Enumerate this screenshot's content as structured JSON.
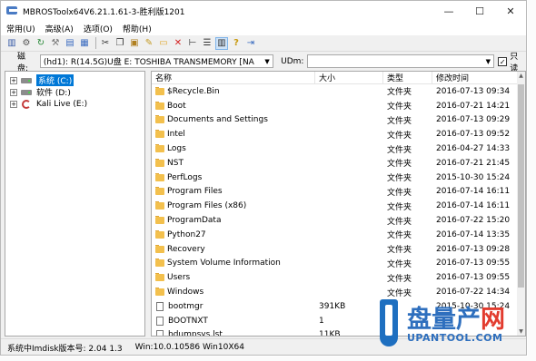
{
  "window": {
    "title": "MBROSToolx64V6.21.1.61-3-胜利版1201",
    "minimize_glyph": "—",
    "maximize_glyph": "☐",
    "close_glyph": "✕"
  },
  "menu": [
    {
      "label": "常用(U)"
    },
    {
      "label": "高级(A)"
    },
    {
      "label": "选项(O)"
    },
    {
      "label": "帮助(H)"
    }
  ],
  "toolbar": {
    "icons": [
      "book-icon",
      "gear-icon",
      "refresh-icon",
      "tools-icon",
      "backup-icon",
      "restore-icon",
      "cut-icon",
      "copy-icon",
      "paste-icon",
      "edit-icon",
      "new-folder-icon",
      "delete-icon",
      "tree-view-icon",
      "list-view-icon",
      "details-view-icon",
      "help-icon",
      "exit-icon"
    ],
    "glyphs": [
      "▥",
      "⚙",
      "↻",
      "⚒",
      "▤",
      "▦",
      "✂",
      "❐",
      "▣",
      "✎",
      "▭",
      "✕",
      "⊢",
      "☰",
      "▥",
      "?",
      "⇥"
    ]
  },
  "diskbar": {
    "disk_label": "磁盘:",
    "disk_value": "(hd1): R(14.5G)U盘  E: TOSHIBA  TRANSMEMORY [NA",
    "ud_label": "UDm:",
    "ud_value": "",
    "readonly_checked": true,
    "readonly_label": "只读"
  },
  "tree": {
    "items": [
      {
        "label": "系统 (C:)",
        "expand": "+",
        "icon": "drive-icon",
        "selected": true
      },
      {
        "label": "软件 (D:)",
        "expand": "+",
        "icon": "drive-icon",
        "selected": false
      },
      {
        "label": "Kali Live (E:)",
        "expand": "+",
        "icon": "kali-drive-icon",
        "selected": false
      }
    ]
  },
  "list": {
    "columns": {
      "name": "名称",
      "size": "大小",
      "type": "类型",
      "time": "修改时间"
    },
    "rows": [
      {
        "name": "$Recycle.Bin",
        "size": "",
        "type": "文件夹",
        "time": "2016-07-13 09:34",
        "icon": "folder"
      },
      {
        "name": "Boot",
        "size": "",
        "type": "文件夹",
        "time": "2016-07-21 14:21",
        "icon": "folder"
      },
      {
        "name": "Documents and Settings",
        "size": "",
        "type": "文件夹",
        "time": "2016-07-13 09:29",
        "icon": "folder"
      },
      {
        "name": "Intel",
        "size": "",
        "type": "文件夹",
        "time": "2016-07-13 09:52",
        "icon": "folder"
      },
      {
        "name": "Logs",
        "size": "",
        "type": "文件夹",
        "time": "2016-04-27 14:33",
        "icon": "folder"
      },
      {
        "name": "NST",
        "size": "",
        "type": "文件夹",
        "time": "2016-07-21 21:45",
        "icon": "folder"
      },
      {
        "name": "PerfLogs",
        "size": "",
        "type": "文件夹",
        "time": "2015-10-30 15:24",
        "icon": "folder"
      },
      {
        "name": "Program Files",
        "size": "",
        "type": "文件夹",
        "time": "2016-07-14 16:11",
        "icon": "folder"
      },
      {
        "name": "Program Files (x86)",
        "size": "",
        "type": "文件夹",
        "time": "2016-07-14 16:11",
        "icon": "folder"
      },
      {
        "name": "ProgramData",
        "size": "",
        "type": "文件夹",
        "time": "2016-07-22 15:20",
        "icon": "folder"
      },
      {
        "name": "Python27",
        "size": "",
        "type": "文件夹",
        "time": "2016-07-14 13:35",
        "icon": "folder"
      },
      {
        "name": "Recovery",
        "size": "",
        "type": "文件夹",
        "time": "2016-07-13 09:28",
        "icon": "folder"
      },
      {
        "name": "System Volume Information",
        "size": "",
        "type": "文件夹",
        "time": "2016-07-13 09:55",
        "icon": "folder"
      },
      {
        "name": "Users",
        "size": "",
        "type": "文件夹",
        "time": "2016-07-13 09:55",
        "icon": "folder"
      },
      {
        "name": "Windows",
        "size": "",
        "type": "文件夹",
        "time": "2016-07-22 14:34",
        "icon": "folder"
      },
      {
        "name": "bootmgr",
        "size": "391KB",
        "type": "",
        "time": "2015-10-30 15:24",
        "icon": "file"
      },
      {
        "name": "BOOTNXT",
        "size": "1",
        "type": "",
        "time": "",
        "icon": "file"
      },
      {
        "name": "bdumpsys.lst",
        "size": "11KB",
        "type": "",
        "time": "",
        "icon": "file"
      }
    ]
  },
  "statusbar": {
    "imdisk": "系统中Imdisk版本号: 2.04 1.3",
    "os": "Win:10.0.10586 Win10X64"
  },
  "watermark": {
    "brand_blue": "盘量产",
    "brand_red": "网",
    "domain": "UPANTOOL.COM",
    "color_blue": "#2e6fbe",
    "color_red": "#e23b2e"
  }
}
